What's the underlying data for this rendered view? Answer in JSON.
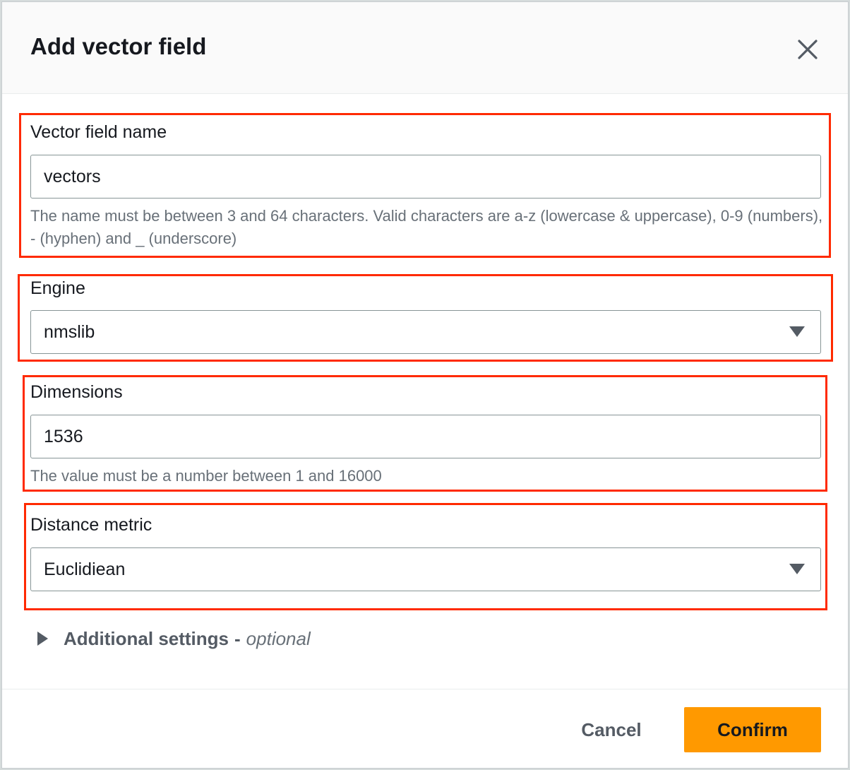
{
  "modal": {
    "title": "Add vector field",
    "close_icon": "close-icon"
  },
  "fields": {
    "name": {
      "label": "Vector field name",
      "value": "vectors",
      "hint": "The name must be between 3 and 64 characters. Valid characters are a-z (lowercase & uppercase), 0-9 (numbers), - (hyphen) and _ (underscore)"
    },
    "engine": {
      "label": "Engine",
      "value": "nmslib"
    },
    "dimensions": {
      "label": "Dimensions",
      "value": "1536",
      "hint": "The value must be a number between 1 and 16000"
    },
    "distance_metric": {
      "label": "Distance metric",
      "value": "Euclidiean"
    }
  },
  "additional_settings": {
    "label": "Additional settings",
    "separator": "-",
    "optional": "optional"
  },
  "footer": {
    "cancel_label": "Cancel",
    "confirm_label": "Confirm"
  },
  "colors": {
    "highlight": "#ff2a00",
    "primary_button": "#ff9900"
  }
}
